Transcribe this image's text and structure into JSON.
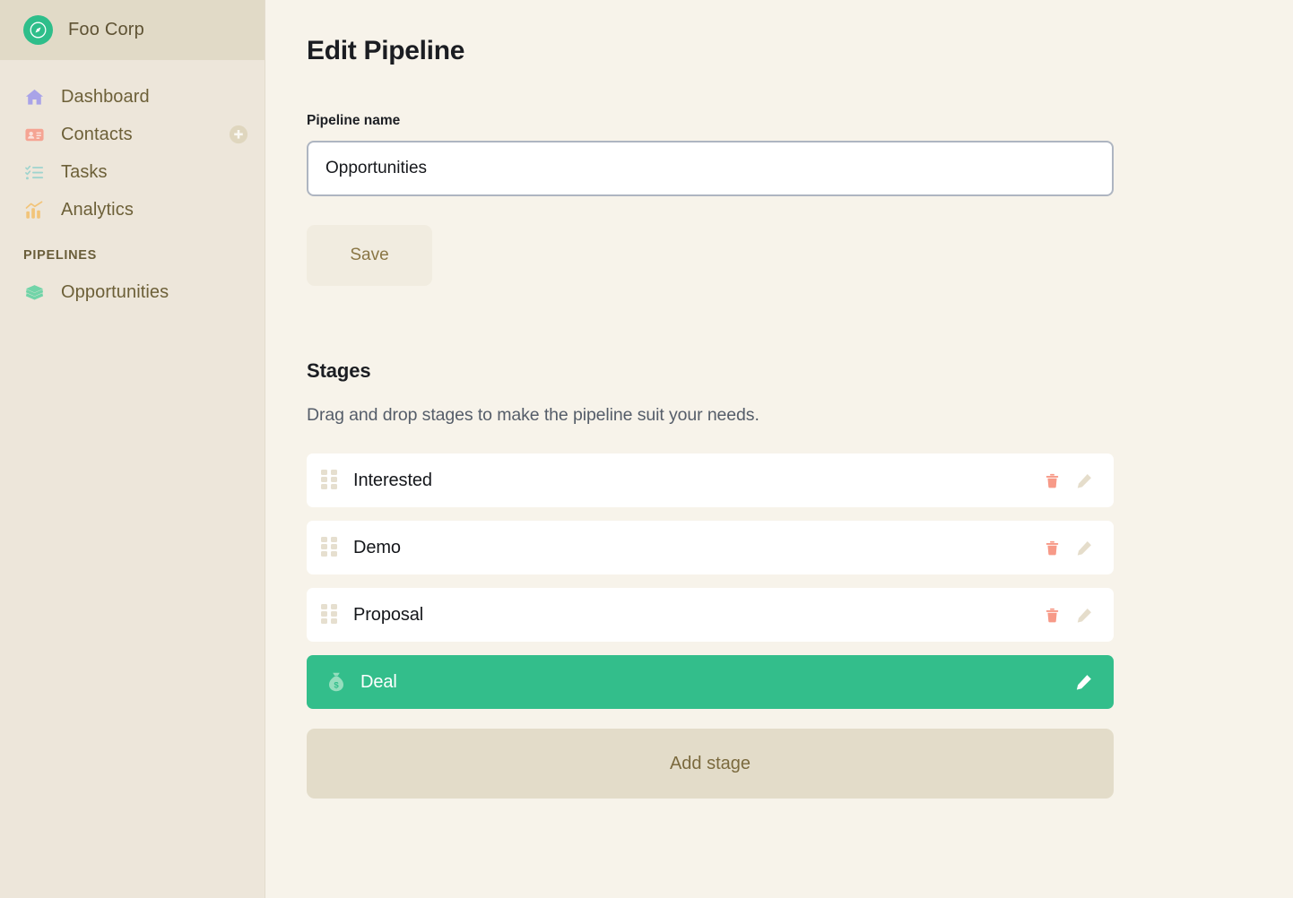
{
  "sidebar": {
    "brand": {
      "name": "Foo Corp",
      "logo_icon": "compass-icon",
      "logo_color": "#2EBE8A"
    },
    "nav_items": [
      {
        "label": "Dashboard",
        "icon": "home-icon",
        "color": "#A9A3E8",
        "action": null
      },
      {
        "label": "Contacts",
        "icon": "id-card-icon",
        "color": "#F5A493",
        "action": "add-contact-button"
      },
      {
        "label": "Tasks",
        "icon": "checklist-icon",
        "color": "#9FD4CE",
        "action": null
      },
      {
        "label": "Analytics",
        "icon": "bar-chart-icon",
        "color": "#F2C479",
        "action": null
      }
    ],
    "section_title": "PIPELINES",
    "pipelines": [
      {
        "label": "Opportunities",
        "icon": "layers-icon",
        "color": "#71D4A8"
      }
    ]
  },
  "main": {
    "page_title": "Edit Pipeline",
    "pipeline_name": {
      "label": "Pipeline name",
      "value": "Opportunities",
      "placeholder": "Pipeline name"
    },
    "save_label": "Save",
    "stages_heading": "Stages",
    "stages_subtitle": "Drag and drop stages to make the pipeline suit your needs.",
    "stages": [
      {
        "name": "Interested",
        "active": false,
        "lead_icon": null,
        "can_delete": true,
        "can_edit": true
      },
      {
        "name": "Demo",
        "active": false,
        "lead_icon": null,
        "can_delete": true,
        "can_edit": true
      },
      {
        "name": "Proposal",
        "active": false,
        "lead_icon": null,
        "can_delete": true,
        "can_edit": true
      },
      {
        "name": "Deal",
        "active": true,
        "lead_icon": "money-bag-icon",
        "can_delete": false,
        "can_edit": true
      }
    ],
    "add_stage_label": "Add stage",
    "colors": {
      "accent_green": "#33BE8B",
      "delete_red": "#F79A88",
      "edit_tan": "#E5DDCB",
      "sidebar_bg": "#EDE6DA",
      "main_bg": "#F7F3EA"
    }
  }
}
